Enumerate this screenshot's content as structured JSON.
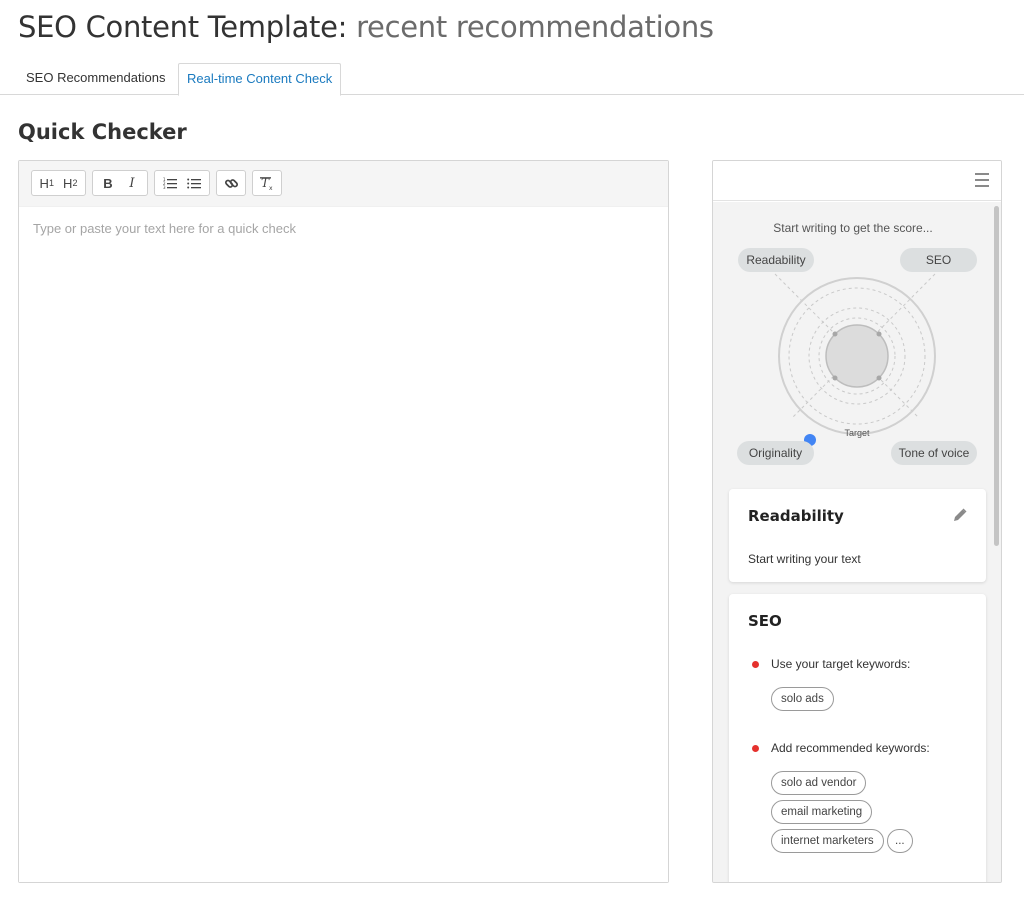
{
  "header": {
    "title_main": "SEO Content Template:",
    "title_sub": "recent recommendations"
  },
  "tabs": [
    {
      "label": "SEO Recommendations",
      "active": false
    },
    {
      "label": "Real-time Content Check",
      "active": true
    }
  ],
  "section_title": "Quick Checker",
  "editor": {
    "placeholder": "Type or paste your text here for a quick check",
    "toolbar": {
      "h1": "H1",
      "h2": "H2",
      "bold": "B",
      "italic": "I"
    }
  },
  "score_panel": {
    "hint": "Start writing to get the score...",
    "axes": [
      "Readability",
      "SEO",
      "Originality",
      "Tone of voice"
    ],
    "target_label": "Target",
    "accent_color": "#4285f4"
  },
  "readability": {
    "title": "Readability",
    "text": "Start writing your text"
  },
  "seo": {
    "title": "SEO",
    "target_label": "Use your target keywords:",
    "target_keywords": [
      "solo ads"
    ],
    "recommended_label": "Add recommended keywords:",
    "recommended_keywords": [
      "solo ad vendor",
      "email marketing",
      "internet marketers"
    ],
    "more": "..."
  }
}
